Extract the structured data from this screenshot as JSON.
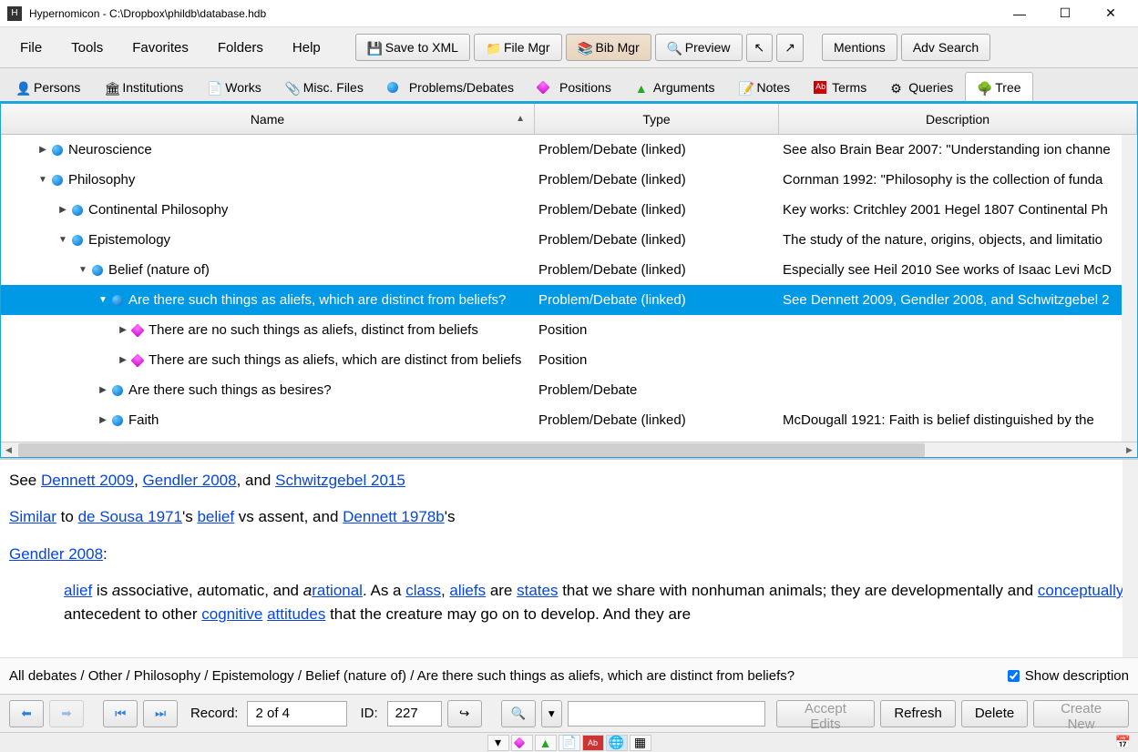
{
  "window": {
    "title": "Hypernomicon - C:\\Dropbox\\phildb\\database.hdb"
  },
  "menu": [
    "File",
    "Tools",
    "Favorites",
    "Folders",
    "Help"
  ],
  "toolbar": [
    {
      "label": "Save to XML",
      "icon": "save"
    },
    {
      "label": "File Mgr",
      "icon": "filemgr"
    },
    {
      "label": "Bib Mgr",
      "icon": "bib"
    },
    {
      "label": "Preview",
      "icon": "preview"
    }
  ],
  "toolbar_icons_only": [
    "pointer-a",
    "pointer-b"
  ],
  "toolbar_right": [
    "Mentions",
    "Adv Search"
  ],
  "tabs": [
    {
      "label": "Persons",
      "icon": "person",
      "active": false
    },
    {
      "label": "Institutions",
      "icon": "institution",
      "active": false
    },
    {
      "label": "Works",
      "icon": "work",
      "active": false
    },
    {
      "label": "Misc. Files",
      "icon": "file",
      "active": false
    },
    {
      "label": "Problems/Debates",
      "icon": "blue",
      "active": false
    },
    {
      "label": "Positions",
      "icon": "pink",
      "active": false
    },
    {
      "label": "Arguments",
      "icon": "green",
      "active": false
    },
    {
      "label": "Notes",
      "icon": "note",
      "active": false
    },
    {
      "label": "Terms",
      "icon": "term",
      "active": false
    },
    {
      "label": "Queries",
      "icon": "query",
      "active": false
    },
    {
      "label": "Tree",
      "icon": "tree",
      "active": true
    }
  ],
  "tree_headers": {
    "name": "Name",
    "type": "Type",
    "desc": "Description"
  },
  "tree_rows": [
    {
      "indent": 0,
      "exp": "▶",
      "icon": "blue",
      "name": "Neuroscience",
      "type": "Problem/Debate (linked)",
      "desc": "See also Brain Bear 2007: \"Understanding ion channe"
    },
    {
      "indent": 0,
      "exp": "▼",
      "icon": "blue",
      "name": "Philosophy",
      "type": "Problem/Debate (linked)",
      "desc": "Cornman 1992: \"Philosophy is the collection of funda"
    },
    {
      "indent": 1,
      "exp": "▶",
      "icon": "blue",
      "name": "Continental Philosophy",
      "type": "Problem/Debate (linked)",
      "desc": "Key works: Critchley 2001 Hegel 1807 Continental Ph"
    },
    {
      "indent": 1,
      "exp": "▼",
      "icon": "blue",
      "name": "Epistemology",
      "type": "Problem/Debate (linked)",
      "desc": "The study of the nature, origins, objects, and limitatio"
    },
    {
      "indent": 2,
      "exp": "▼",
      "icon": "blue",
      "name": "Belief (nature of)",
      "type": "Problem/Debate (linked)",
      "desc": "Especially see Heil 2010 See works of Isaac Levi McD"
    },
    {
      "indent": 3,
      "exp": "▼",
      "icon": "blue",
      "selected": true,
      "name": "Are there such things as aliefs, which are distinct from beliefs?",
      "type": "Problem/Debate (linked)",
      "desc": "See Dennett 2009, Gendler 2008, and Schwitzgebel 2"
    },
    {
      "indent": 4,
      "exp": "▶",
      "icon": "pink",
      "name": "There are no such things as aliefs, distinct from beliefs",
      "type": "Position",
      "desc": ""
    },
    {
      "indent": 4,
      "exp": "▶",
      "icon": "pink",
      "name": "There are such things as aliefs, which are distinct from beliefs",
      "type": "Position",
      "desc": ""
    },
    {
      "indent": 3,
      "exp": "▶",
      "icon": "blue",
      "name": "Are there such things as besires?",
      "type": "Problem/Debate",
      "desc": ""
    },
    {
      "indent": 3,
      "exp": "▶",
      "icon": "blue",
      "name": "Faith",
      "type": "Problem/Debate (linked)",
      "desc": "McDougall 1921: Faith is belief distinguished by the"
    }
  ],
  "description": {
    "line1_pre": "See ",
    "dennett2009": "Dennett 2009",
    "comma": ", ",
    "gendler2008": "Gendler 2008",
    "and": ", and ",
    "schwitzgebel": "Schwitzgebel 2015",
    "similar": "Similar",
    "to": " to ",
    "sousa": "de Sousa 1971",
    "sousa_post": "'s ",
    "belief": "belief",
    "vs": " vs assent, and ",
    "dennett1978": "Dennett 1978b",
    "dennett_post": "'s",
    "gendler2": "Gendler 2008",
    "colon": ":",
    "body_a": "alief",
    "body_txt1": " is ",
    "body_b": "a",
    "body_txt2": "ssociative, ",
    "body_c": "a",
    "body_txt3": "utomatic, and ",
    "body_d": "a",
    "body_e": "rational",
    "body_txt4": ". As a ",
    "class": "class",
    "body_txt5": ", ",
    "aliefs": "aliefs",
    "body_txt6": " are ",
    "states": "states",
    "body_txt7": " that we share with nonhuman animals; they are developmentally and ",
    "conceptually": "conceptually",
    "body_txt8": " antecedent to other ",
    "cognitive": "cognitive",
    "sp": " ",
    "attitudes": "attitudes",
    "body_txt9": " that the creature may go on to develop. And they are"
  },
  "breadcrumb": "All debates / Other / Philosophy / Epistemology / Belief (nature of) / Are there such things as aliefs, which are distinct from beliefs?",
  "show_desc": "Show description",
  "bottom": {
    "record_label": "Record:",
    "record_value": "2 of 4",
    "id_label": "ID:",
    "id_value": "227",
    "accept": "Accept Edits",
    "refresh": "Refresh",
    "delete": "Delete",
    "create": "Create New"
  }
}
